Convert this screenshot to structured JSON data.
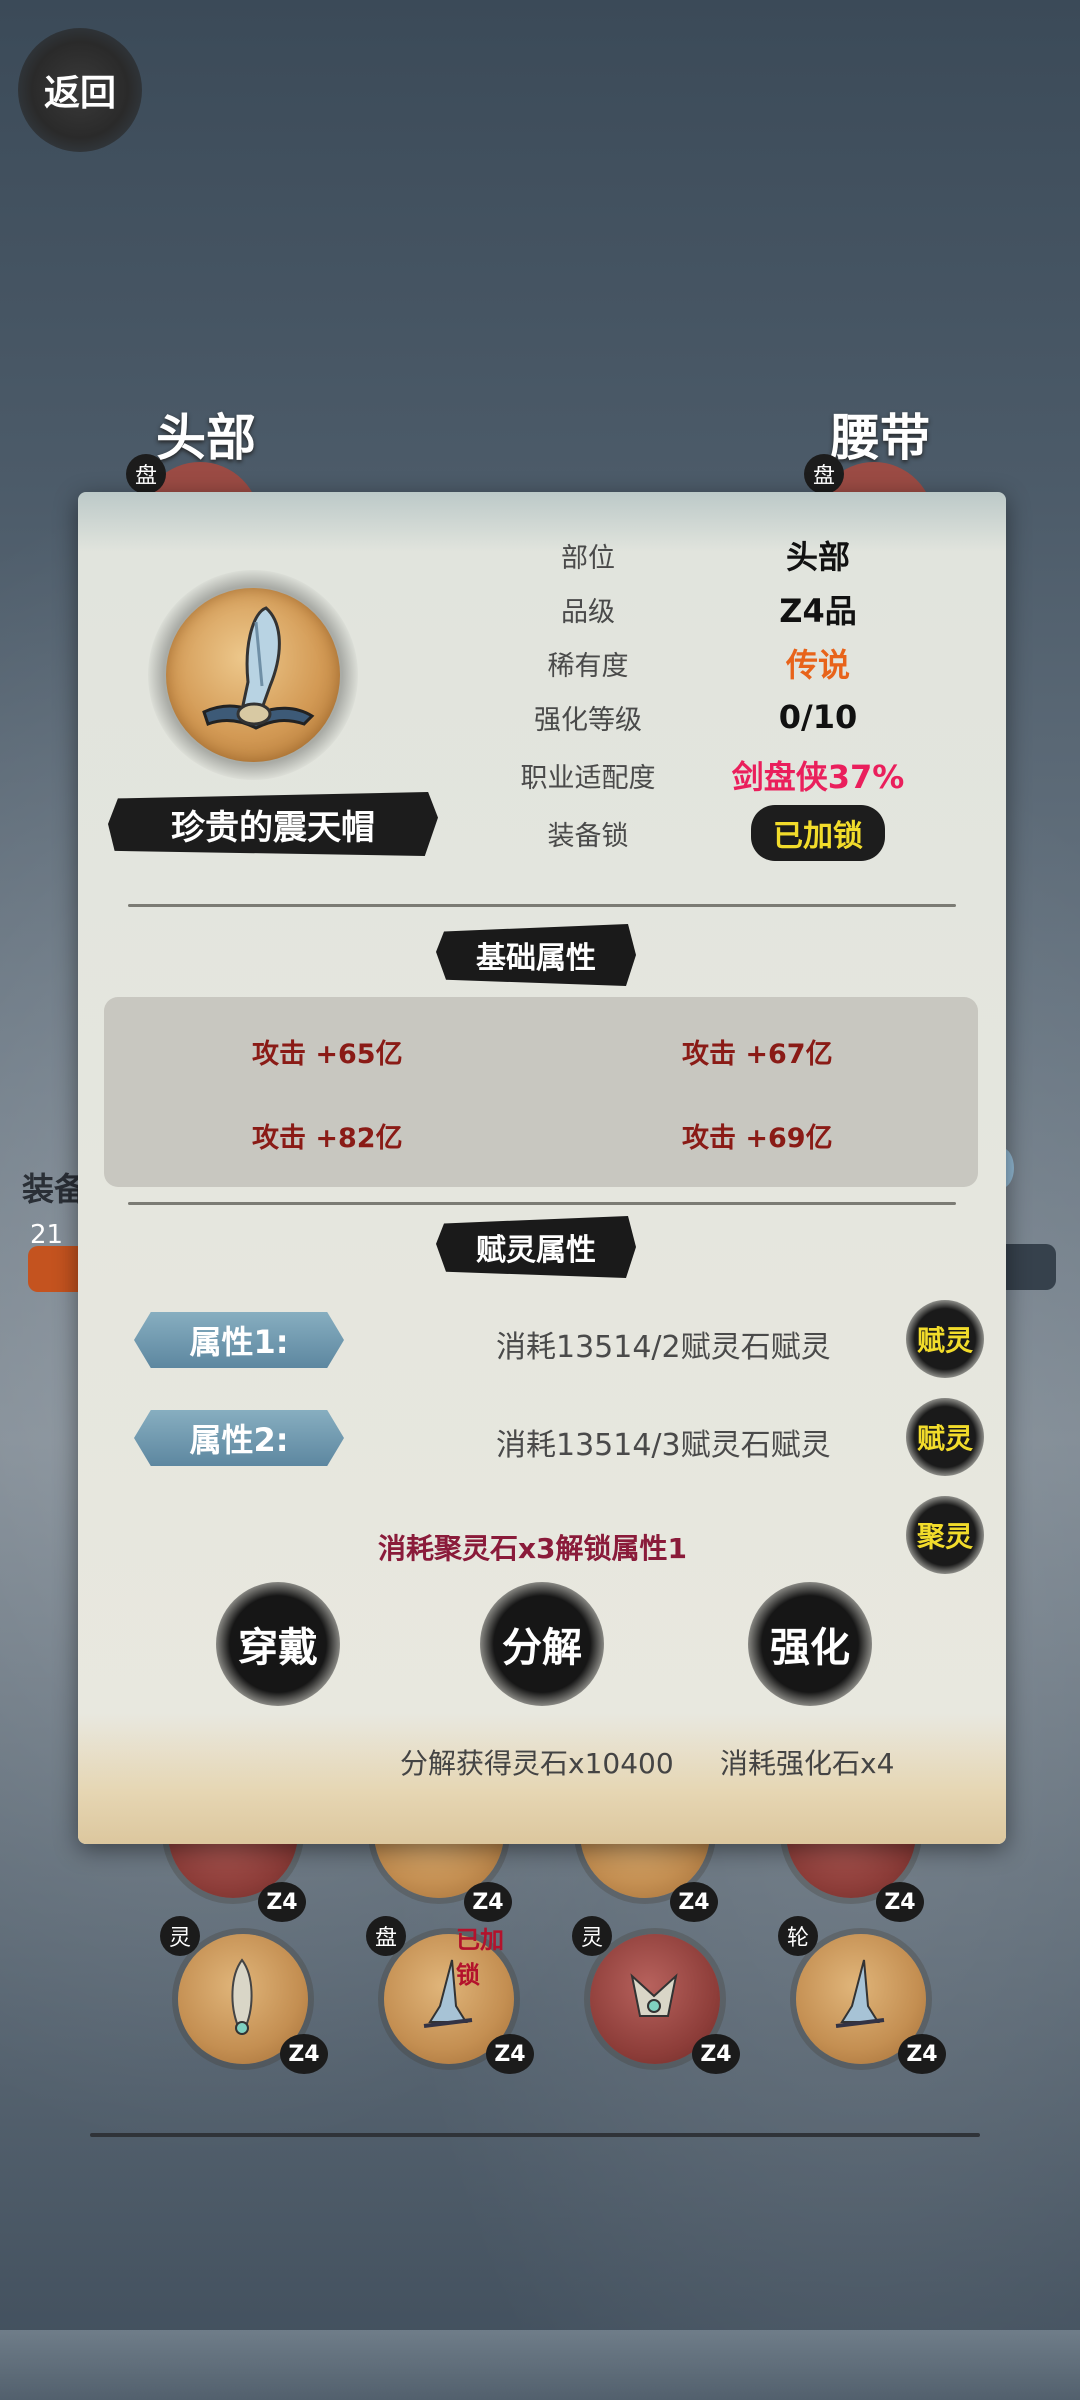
{
  "back_label": "返回",
  "slots": {
    "head": "头部",
    "belt": "腰带",
    "badge": "盘"
  },
  "side": {
    "label": "装备",
    "number": "21"
  },
  "inventory": [
    {
      "tag": "灵",
      "level": "Z4",
      "color": "gold",
      "locked": ""
    },
    {
      "tag": "盘",
      "level": "Z4",
      "color": "gold",
      "locked": "已加锁"
    },
    {
      "tag": "灵",
      "level": "Z4",
      "color": "red",
      "locked": ""
    },
    {
      "tag": "轮",
      "level": "Z4",
      "color": "gold",
      "locked": ""
    }
  ],
  "upper_row_levels": [
    "Z4",
    "Z4",
    "Z4",
    "Z4"
  ],
  "item": {
    "name": "珍贵的震天帽",
    "attributes": [
      {
        "label": "部位",
        "value": "头部"
      },
      {
        "label": "品级",
        "value": "Z4品"
      },
      {
        "label": "稀有度",
        "value": "传说"
      },
      {
        "label": "强化等级",
        "value": "0/10"
      },
      {
        "label": "职业适配度",
        "value": "剑盘侠37%"
      },
      {
        "label": "装备锁",
        "value": "已加锁"
      }
    ]
  },
  "base_section": {
    "title": "基础属性",
    "stats": [
      "攻击 +65亿",
      "攻击 +67亿",
      "攻击 +82亿",
      "攻击 +69亿"
    ]
  },
  "spirit_section": {
    "title": "赋灵属性",
    "rows": [
      {
        "label": "属性1:",
        "cost": "消耗13514/2赋灵石赋灵",
        "button": "赋灵"
      },
      {
        "label": "属性2:",
        "cost": "消耗13514/3赋灵石赋灵",
        "button": "赋灵"
      }
    ],
    "unlock_text": "消耗聚灵石x3解锁属性1",
    "unlock_button": "聚灵"
  },
  "actions": {
    "wear": "穿戴",
    "decompose": "分解",
    "enhance": "强化",
    "decompose_note": "分解获得灵石x10400",
    "enhance_note": "消耗强化石x4"
  },
  "colors": {
    "rarity": "#e8631a",
    "fit": "#ea1f5c",
    "lock_text": "#f2dc2b",
    "stat": "#8a1b16"
  }
}
